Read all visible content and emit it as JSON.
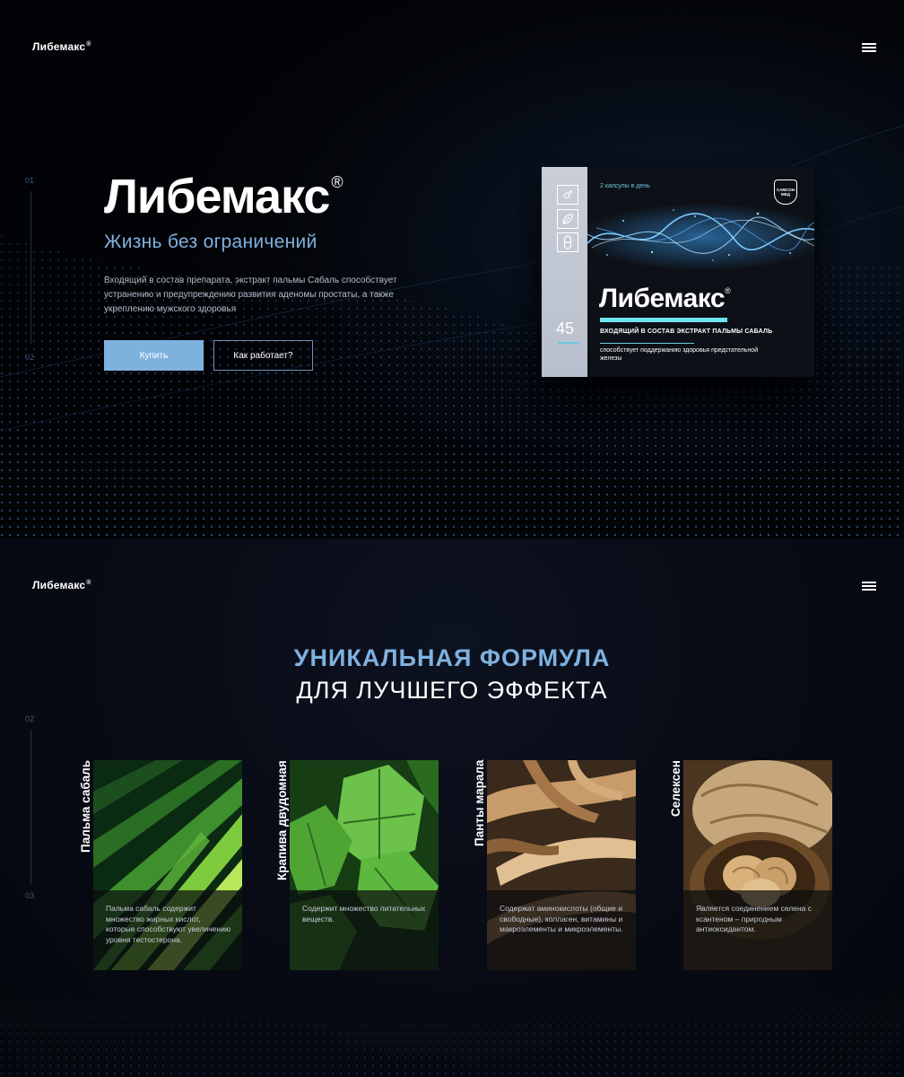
{
  "hero": {
    "logo": "Либемакс",
    "logo_mark": "®",
    "steps": [
      "01",
      "02"
    ],
    "title": "Либемакс",
    "title_mark": "®",
    "subtitle": "Жизнь без ограничений",
    "description": "Входящий в состав препарата, экстракт пальмы Сабаль способствует устранению и предупреждению развития аденомы простаты, а также укреплению мужского здоровья",
    "buy_button": "Купить",
    "how_button": "Как работает?"
  },
  "product": {
    "capsules": "2 капсулы в день",
    "brand_badge": "САМСОН МЕД",
    "side_number": "45",
    "title": "Либемакс",
    "title_mark": "®",
    "line1": "ВХОДЯЩИЙ В СОСТАВ ЭКСТРАКТ ПАЛЬМЫ САБАЛЬ",
    "line2": "способствует поддержанию здоровья предстательной железы",
    "icons": [
      "male-symbol-icon",
      "leaf-icon",
      "capsule-icon"
    ]
  },
  "formula": {
    "logo": "Либемакс",
    "logo_mark": "®",
    "steps": [
      "02",
      "03"
    ],
    "heading_accent": "УНИКАЛЬНАЯ ФОРМУЛА",
    "heading": "ДЛЯ ЛУЧШЕГО ЭФФЕКТА",
    "cards": [
      {
        "label": "Пальма сабаль",
        "text": "Пальма сабаль содержит множество жирных кислот, которые способствуют увеличению уровня тестостерона."
      },
      {
        "label": "Крапива двудомная",
        "text": "Содержит множество питательных веществ."
      },
      {
        "label": "Панты марала",
        "text": "Содержат аминокислоты (общие и свободные), коллаген, витамины и макроэлементы и микроэлементы."
      },
      {
        "label": "Селексен",
        "text": "Является соединением селена с ксантеном – природным антиоксидантом."
      }
    ]
  },
  "colors": {
    "accent": "#7fb1df",
    "cyan": "#6ee3ef",
    "background": "#020306"
  }
}
